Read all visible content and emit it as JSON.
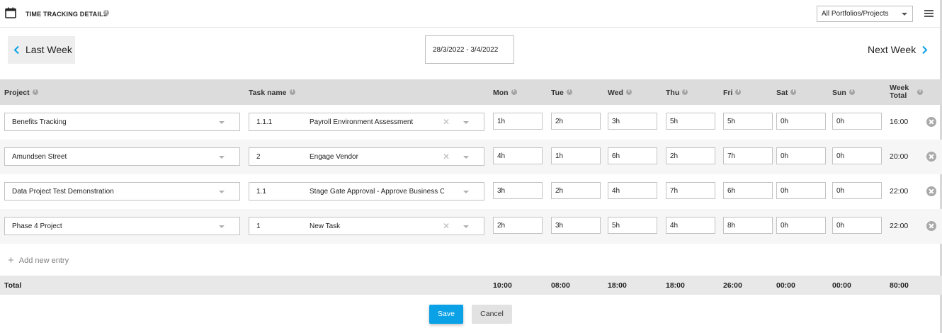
{
  "header": {
    "title": "TIME TRACKING DETAILS",
    "portfolio_filter": "All Portfolios/Projects"
  },
  "nav": {
    "last_week": "Last Week",
    "date_range": "28/3/2022 - 3/4/2022",
    "next_week": "Next Week"
  },
  "columns": {
    "project": "Project",
    "task_name": "Task name",
    "mon": "Mon",
    "tue": "Tue",
    "wed": "Wed",
    "thu": "Thu",
    "fri": "Fri",
    "sat": "Sat",
    "sun": "Sun",
    "week_total_1": "Week",
    "week_total_2": "Total"
  },
  "rows": [
    {
      "project": "Benefits Tracking",
      "task_id": "1.1.1",
      "task_name": "Payroll Environment Assessment",
      "task_clearable": true,
      "hours": [
        "1h",
        "2h",
        "3h",
        "5h",
        "5h",
        "0h",
        "0h"
      ],
      "total": "16:00"
    },
    {
      "project": "Amundsen Street",
      "task_id": "2",
      "task_name": "Engage Vendor",
      "task_clearable": true,
      "hours": [
        "4h",
        "1h",
        "6h",
        "2h",
        "7h",
        "0h",
        "0h"
      ],
      "total": "20:00"
    },
    {
      "project": "Data Project Test Demonstration",
      "task_id": "1.1",
      "task_name": "Stage Gate Approval - Approve Business Case",
      "task_clearable": false,
      "hours": [
        "3h",
        "2h",
        "4h",
        "7h",
        "6h",
        "0h",
        "0h"
      ],
      "total": "22:00"
    },
    {
      "project": "Phase 4 Project",
      "task_id": "1",
      "task_name": "New Task",
      "task_clearable": true,
      "hours": [
        "2h",
        "3h",
        "5h",
        "4h",
        "8h",
        "0h",
        "0h"
      ],
      "total": "22:00"
    }
  ],
  "add_entry": "Add new entry",
  "totals": {
    "label": "Total",
    "days": [
      "10:00",
      "08:00",
      "18:00",
      "18:00",
      "26:00",
      "00:00",
      "00:00"
    ],
    "week": "80:00"
  },
  "actions": {
    "save": "Save",
    "cancel": "Cancel"
  },
  "colors": {
    "accent": "#0aa1e6",
    "header_bg": "#dcdcdc",
    "total_bg": "#e8e8e8"
  }
}
